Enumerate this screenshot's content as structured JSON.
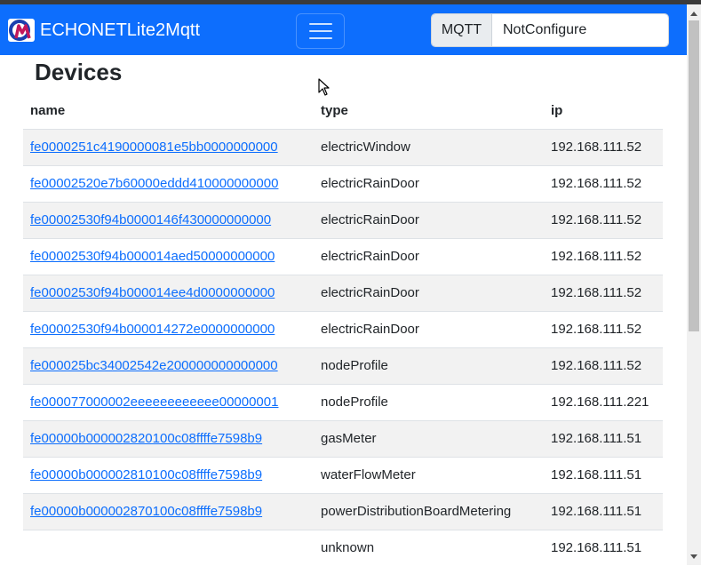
{
  "brand": {
    "title": "ECHONETLite2Mqtt",
    "logo_icon": "echonet-mqtt-logo-icon"
  },
  "colors": {
    "navbar": "#0d6efd",
    "link": "#0d6efd",
    "stripe": "#f2f2f2"
  },
  "mqtt": {
    "label": "MQTT",
    "status": "NotConfigure"
  },
  "page": {
    "title": "Devices"
  },
  "table": {
    "headers": {
      "name": "name",
      "type": "type",
      "ip": "ip"
    },
    "rows": [
      {
        "name": "fe0000251c4190000081e5bb0000000000",
        "type": "electricWindow",
        "ip": "192.168.111.52"
      },
      {
        "name": "fe00002520e7b60000eddd410000000000",
        "type": "electricRainDoor",
        "ip": "192.168.111.52"
      },
      {
        "name": "fe00002530f94b0000146f430000000000",
        "type": "electricRainDoor",
        "ip": "192.168.111.52"
      },
      {
        "name": "fe00002530f94b000014aed50000000000",
        "type": "electricRainDoor",
        "ip": "192.168.111.52"
      },
      {
        "name": "fe00002530f94b000014ee4d0000000000",
        "type": "electricRainDoor",
        "ip": "192.168.111.52"
      },
      {
        "name": "fe00002530f94b000014272e0000000000",
        "type": "electricRainDoor",
        "ip": "192.168.111.52"
      },
      {
        "name": "fe000025bc34002542e200000000000000",
        "type": "nodeProfile",
        "ip": "192.168.111.52"
      },
      {
        "name": "fe000077000002eeeeeeeeeeee00000001",
        "type": "nodeProfile",
        "ip": "192.168.111.221"
      },
      {
        "name": "fe00000b000002820100c08ffffe7598b9",
        "type": "gasMeter",
        "ip": "192.168.111.51"
      },
      {
        "name": "fe00000b000002810100c08ffffe7598b9",
        "type": "waterFlowMeter",
        "ip": "192.168.111.51"
      },
      {
        "name": "fe00000b000002870100c08ffffe7598b9",
        "type": "powerDistributionBoardMetering",
        "ip": "192.168.111.51"
      },
      {
        "name": "",
        "type": "unknown",
        "ip": "192.168.111.51"
      }
    ]
  }
}
